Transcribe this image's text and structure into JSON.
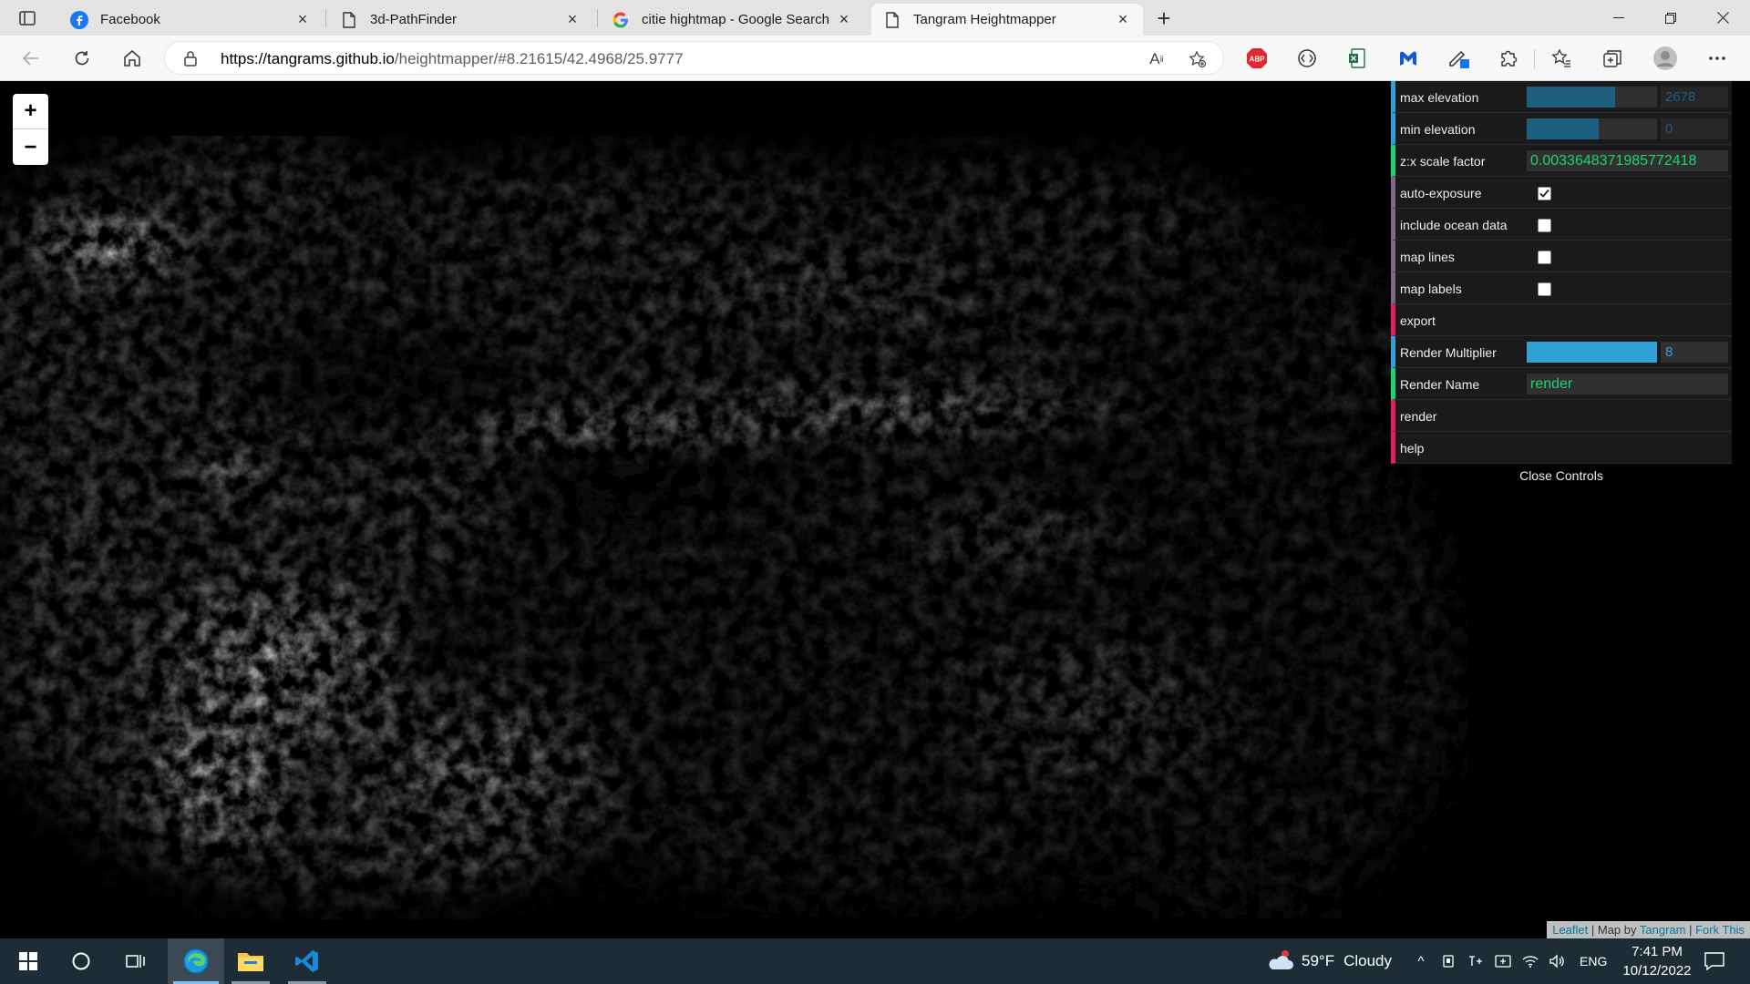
{
  "browser": {
    "tabs": [
      {
        "title": "Facebook",
        "icon": "facebook-icon"
      },
      {
        "title": "3d-PathFinder",
        "icon": "page-icon"
      },
      {
        "title": "citie hightmap - Google Search",
        "icon": "google-icon"
      },
      {
        "title": "Tangram Heightmapper",
        "icon": "page-icon"
      }
    ],
    "active_tab": 3,
    "url_host": "https://tangrams.github.io",
    "url_path": "/heightmapper/#8.21615/42.4968/25.9777",
    "extensions": [
      "adblock-plus-icon",
      "extension-icon",
      "office-icon",
      "malwarebytes-icon",
      "pen-icon",
      "puzzle-icon"
    ],
    "abp_label": "ABP"
  },
  "map": {
    "zoom_in": "+",
    "zoom_out": "−",
    "attribution": {
      "leaflet": "Leaflet",
      "sep1": " | Map by ",
      "tangram": "Tangram",
      "sep2": " | ",
      "fork": "Fork This"
    }
  },
  "controls": {
    "max_elevation": {
      "label": "max elevation",
      "value": "2678",
      "fraction": 0.68
    },
    "min_elevation": {
      "label": "min elevation",
      "value": "0",
      "fraction": 0.55
    },
    "zx_scale": {
      "label": "z:x scale factor",
      "value": "0.0033648371985772418"
    },
    "auto_exposure": {
      "label": "auto-exposure",
      "checked": true
    },
    "include_ocean": {
      "label": "include ocean data",
      "checked": false
    },
    "map_lines": {
      "label": "map lines",
      "checked": false
    },
    "map_labels": {
      "label": "map labels",
      "checked": false
    },
    "export": {
      "label": "export"
    },
    "render_multiplier": {
      "label": "Render Multiplier",
      "value": "8",
      "fraction": 1.0
    },
    "render_name": {
      "label": "Render Name",
      "value": "render"
    },
    "render": {
      "label": "render"
    },
    "help": {
      "label": "help"
    },
    "close": "Close Controls"
  },
  "taskbar": {
    "weather_temp": "59°F",
    "weather_text": "Cloudy",
    "lang": "ENG",
    "time": "7:41 PM",
    "date": "10/12/2022"
  },
  "colors": {
    "number_accent": "#2fa1d6",
    "string_accent": "#1ed36f",
    "function_accent": "#e61d5f",
    "boolean_accent": "#806787"
  }
}
